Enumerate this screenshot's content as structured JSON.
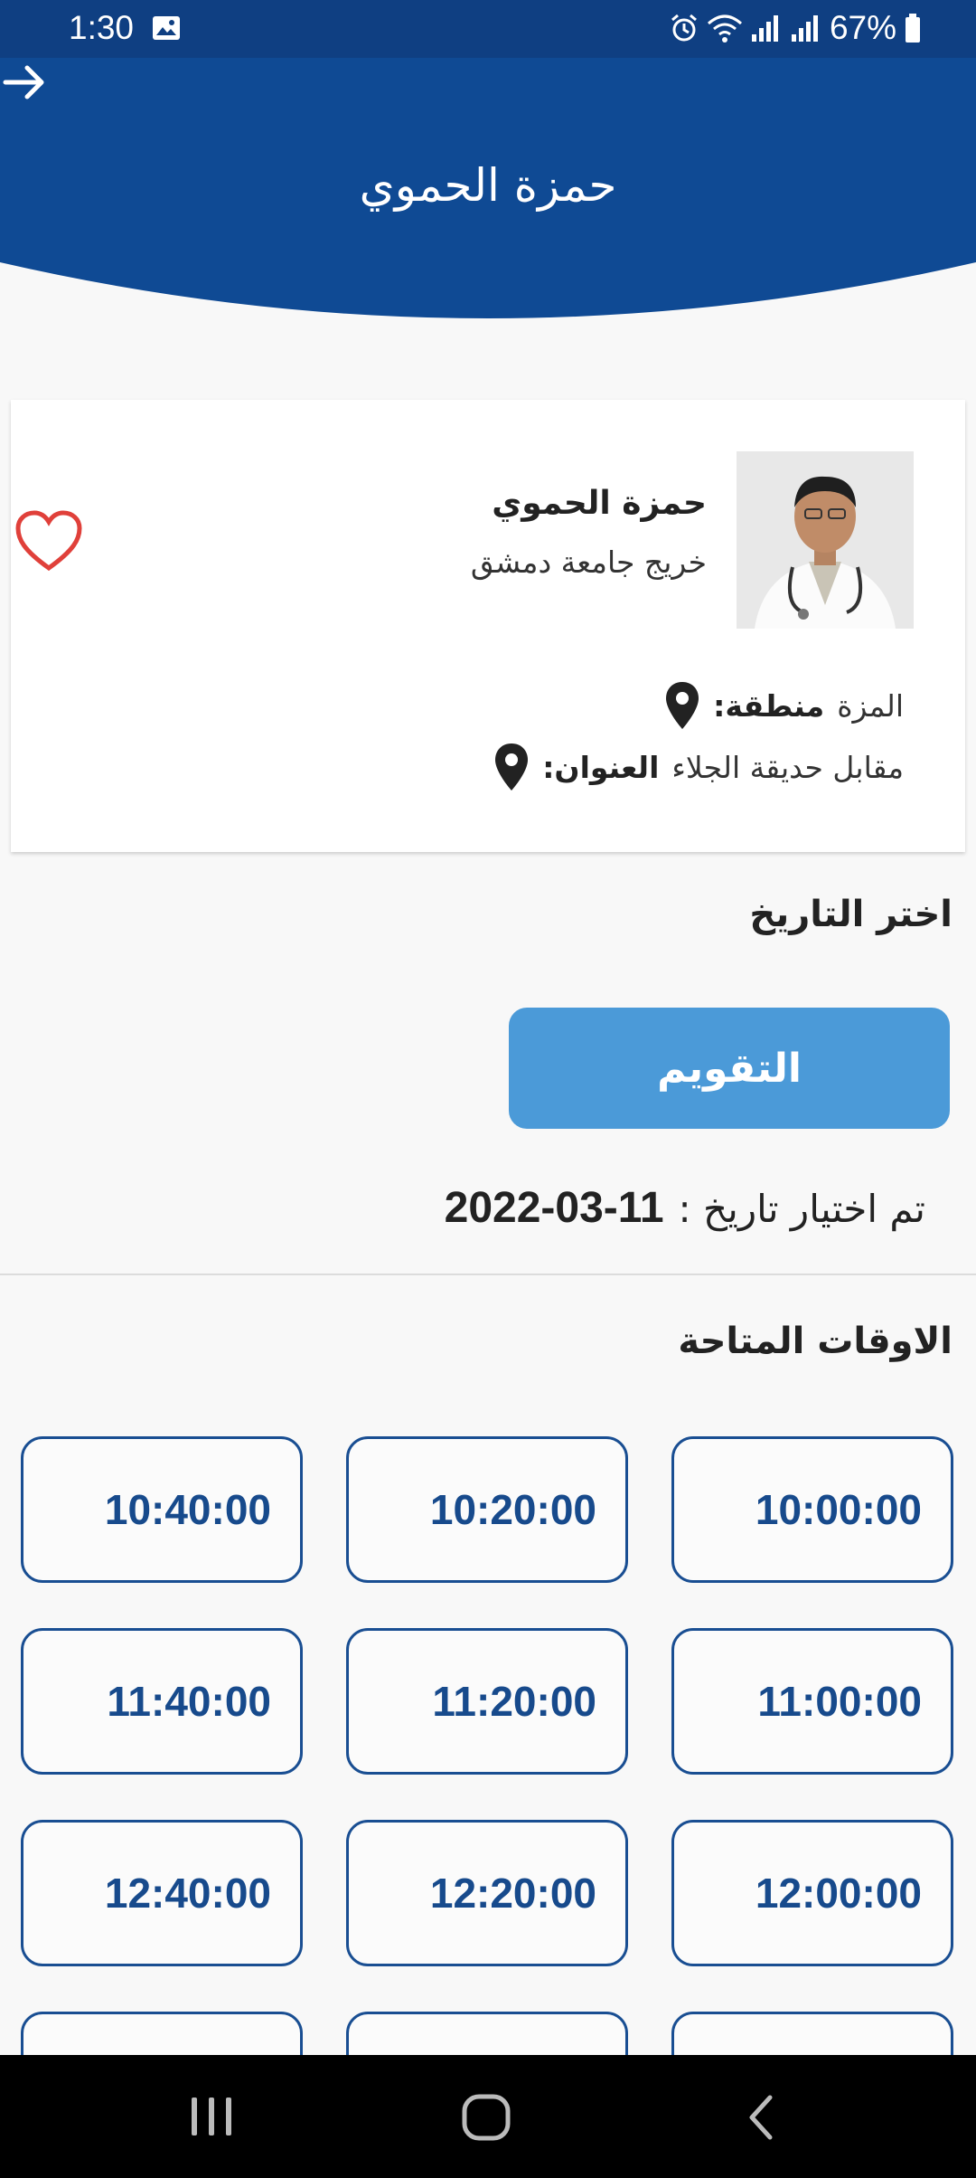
{
  "status_bar": {
    "time": "1:30",
    "battery": "67%"
  },
  "header": {
    "title": "حمزة الحموي"
  },
  "doctor": {
    "name": "حمزة الحموي",
    "subtitle": "خريج جامعة دمشق",
    "region_label": "منطقة:",
    "region_value": "المزة",
    "address_label": "العنوان:",
    "address_value": "مقابل حديقة الجلاء"
  },
  "date_section": {
    "title": "اختر التاريخ",
    "calendar_button": "التقويم",
    "selected_label": "تم اختيار تاريخ :",
    "selected_value": "2022-03-11"
  },
  "times_section": {
    "title": "الاوقات المتاحة",
    "slots": [
      "10:00:00",
      "10:20:00",
      "10:40:00",
      "11:00:00",
      "11:20:00",
      "11:40:00",
      "12:00:00",
      "12:20:00",
      "12:40:00"
    ]
  },
  "colors": {
    "primary": "#0f3f82",
    "accent_button": "#4b9ad8",
    "slot_border": "#194e92",
    "heart": "#e0403a"
  },
  "icons": [
    "gallery-icon",
    "alarm-icon",
    "wifi-icon",
    "signal-icon",
    "battery-icon",
    "back-arrow-icon",
    "favorite-heart-icon",
    "location-pin-icon",
    "recents-icon",
    "home-icon",
    "nav-back-icon"
  ]
}
